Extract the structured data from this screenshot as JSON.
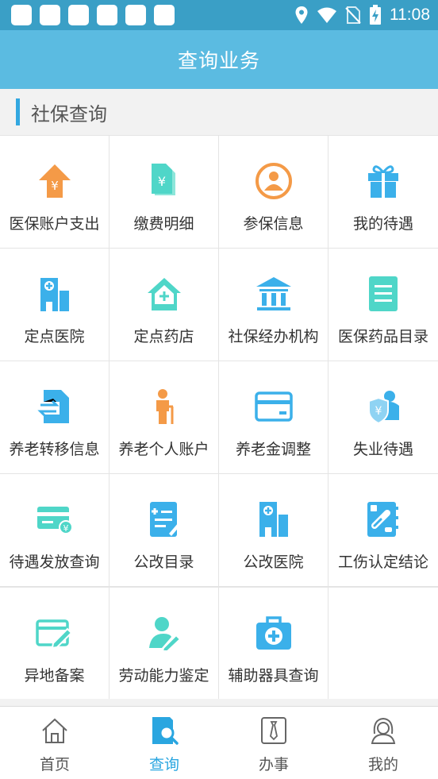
{
  "status_bar": {
    "time": "11:08"
  },
  "header": {
    "title": "查询业务"
  },
  "section": {
    "title": "社保查询"
  },
  "grid": {
    "rows": [
      [
        {
          "label": "医保账户支出",
          "icon": "upload-yen-icon"
        },
        {
          "label": "缴费明细",
          "icon": "payment-document-icon"
        },
        {
          "label": "参保信息",
          "icon": "person-circle-icon"
        },
        {
          "label": "我的待遇",
          "icon": "gift-icon"
        }
      ],
      [
        {
          "label": "定点医院",
          "icon": "hospital-building-icon"
        },
        {
          "label": "定点药店",
          "icon": "pharmacy-house-icon"
        },
        {
          "label": "社保经办机构",
          "icon": "institution-icon"
        },
        {
          "label": "医保药品目录",
          "icon": "list-document-icon"
        }
      ],
      [
        {
          "label": "养老转移信息",
          "icon": "transfer-document-icon"
        },
        {
          "label": "养老个人账户",
          "icon": "elderly-person-icon"
        },
        {
          "label": "养老金调整",
          "icon": "bank-card-icon"
        },
        {
          "label": "失业待遇",
          "icon": "person-shield-icon"
        }
      ],
      [
        {
          "label": "待遇发放查询",
          "icon": "card-coin-icon"
        },
        {
          "label": "公改目录",
          "icon": "edit-document-icon"
        },
        {
          "label": "公改医院",
          "icon": "hospital-tower-icon"
        },
        {
          "label": "工伤认定结论",
          "icon": "medical-record-icon"
        }
      ],
      [
        {
          "label": "异地备案",
          "icon": "card-pen-icon"
        },
        {
          "label": "劳动能力鉴定",
          "icon": "person-pen-icon"
        },
        {
          "label": "辅助器具查询",
          "icon": "medical-kit-icon"
        }
      ]
    ]
  },
  "tabbar": {
    "items": [
      {
        "label": "首页",
        "icon": "home-icon",
        "active": false
      },
      {
        "label": "查询",
        "icon": "search-document-icon",
        "active": true
      },
      {
        "label": "办事",
        "icon": "tie-icon",
        "active": false
      },
      {
        "label": "我的",
        "icon": "user-icon",
        "active": false
      }
    ]
  },
  "colors": {
    "status_bar": "#3a9fc6",
    "header": "#5bbbe1",
    "accent": "#2aa6e0",
    "orange": "#f49a47",
    "teal": "#4fd6c8",
    "blue": "#3bb0ea"
  }
}
